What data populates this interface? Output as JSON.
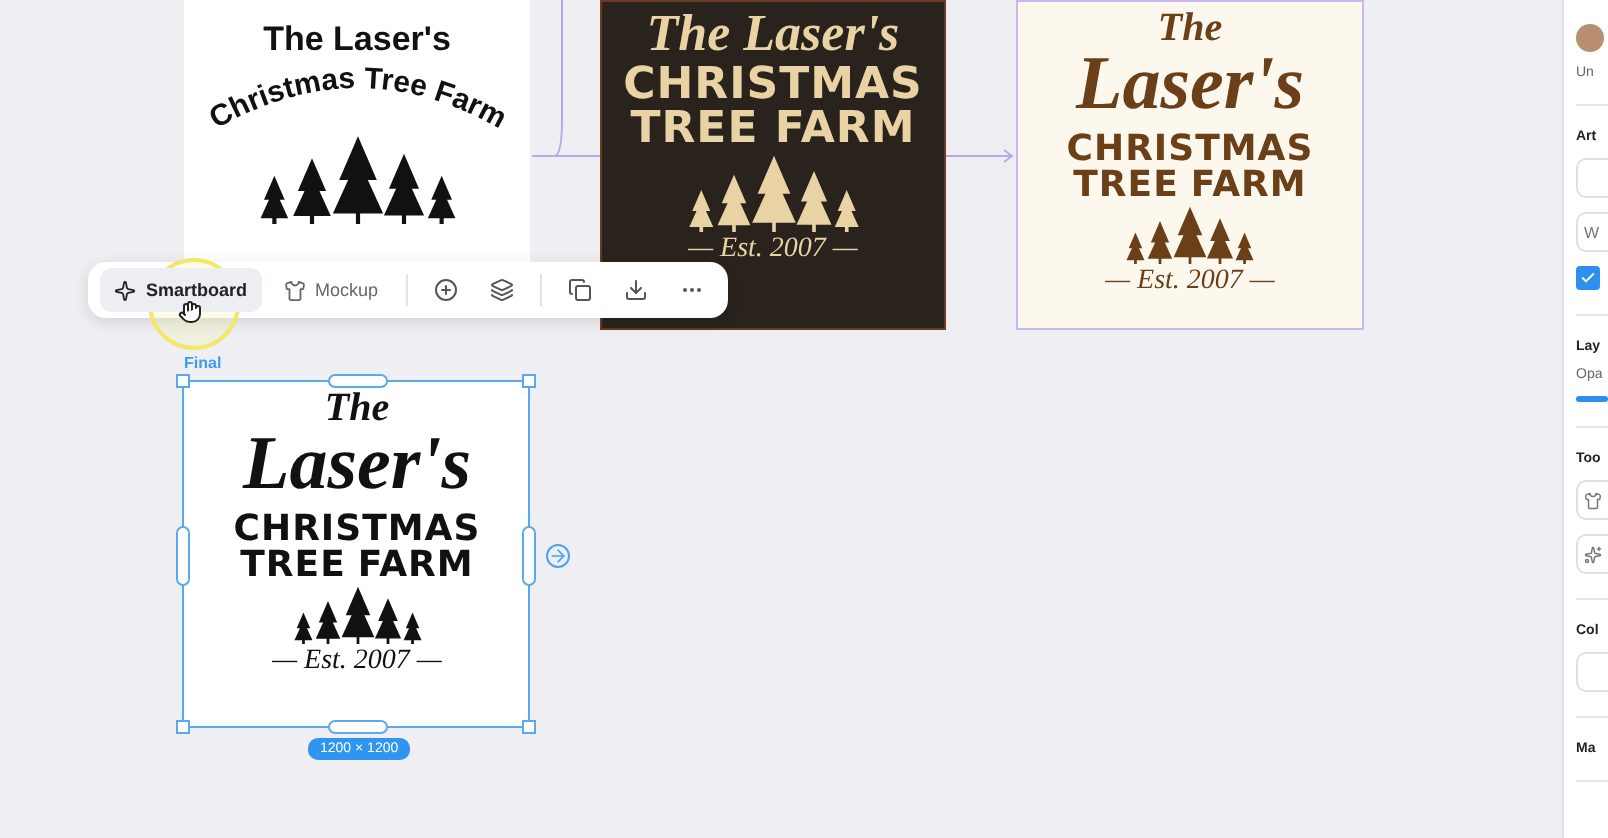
{
  "canvas": {
    "artworks": [
      {
        "kind": "plain",
        "title": "The Laser's",
        "arch": "Christmas Tree Farm"
      },
      {
        "kind": "vintage-dark",
        "script_main": "The Laser's",
        "line1": "CHRISTMAS",
        "line2": "TREE FARM",
        "established": "— Est. 2007 —"
      },
      {
        "kind": "vintage-cream",
        "script_top": "The",
        "script_main": "Laser's",
        "line1": "CHRISTMAS",
        "line2_left": "TREE",
        "line2_right": "FARM",
        "established": "— Est. 2007 —"
      },
      {
        "kind": "final",
        "label": "Final",
        "script_top": "The",
        "script_main": "Laser's",
        "line1": "CHRISTMAS",
        "line2_left": "TREE",
        "line2_right": "FARM",
        "established": "— Est. 2007 —",
        "size": "1200 × 1200",
        "selected": true
      }
    ],
    "toolbar": {
      "buttons": [
        {
          "label": "Smartboard",
          "selected": true
        },
        {
          "label": "Mockup",
          "selected": false
        }
      ]
    }
  },
  "panel": {
    "user": "Un",
    "sections": [
      {
        "title": "Art",
        "fields": [
          {
            "kind": "empty"
          },
          {
            "kind": "text",
            "value": "W"
          }
        ],
        "checked": true
      },
      {
        "title": "Lay",
        "label": "Opa",
        "level": 1
      },
      {
        "title": "Too",
        "tools": [
          {
            "kind": "shirt"
          },
          {
            "kind": "sparkle"
          }
        ]
      },
      {
        "title": "Col",
        "fields": [
          {
            "kind": "empty"
          }
        ]
      },
      {
        "title": "Ma"
      }
    ]
  }
}
